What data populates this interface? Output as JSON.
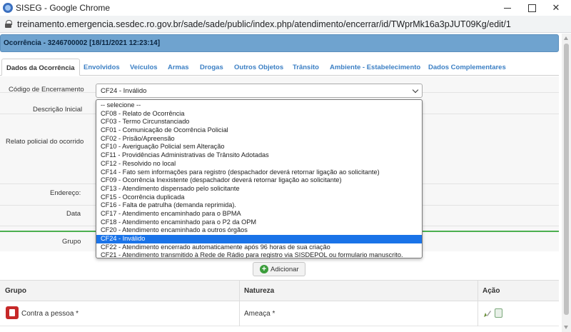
{
  "window": {
    "title": "SISEG - Google Chrome"
  },
  "browser": {
    "url": "treinamento.emergencia.sesdec.ro.gov.br/sade/sade/public/index.php/atendimento/encerrar/id/TWprMk16a3pJUT09Kg/edit/1"
  },
  "occurrence": {
    "header": "Ocorrência - 3246700002 [18/11/2021 12:23:14]"
  },
  "tabs": [
    {
      "label": "Dados da Ocorrência"
    },
    {
      "label": "Envolvidos"
    },
    {
      "label": "Veículos"
    },
    {
      "label": "Armas"
    },
    {
      "label": "Drogas"
    },
    {
      "label": "Outros Objetos"
    },
    {
      "label": "Trânsito"
    },
    {
      "label": "Ambiente - Estabelecimento"
    },
    {
      "label": "Dados Complementares"
    }
  ],
  "form": {
    "codigo_label": "Código de Encerramento",
    "descricao_label": "Descrição Inicial",
    "relato_label": "Relato policial do ocorrido",
    "endereco_label": "Endereço:",
    "data_label": "Data",
    "grupo_label": "Grupo",
    "selected_value": "CF24 - Inválido"
  },
  "dropdown": {
    "options": [
      "-- selecione --",
      "CF08 - Relato de Ocorrência",
      "CF03 - Termo Circunstanciado",
      "CF01 - Comunicação de Ocorrência Policial",
      "CF02 - Prisão/Apreensão",
      "CF10 - Averiguação Policial sem Alteração",
      "CF11 - Providências Administrativas de Trânsito Adotadas",
      "CF12 - Resolvido no local",
      "CF14 - Fato sem informações para registro (despachador deverá retornar ligação ao solicitante)",
      "CF09 - Ocorrência Inexistente (despachador deverá retornar ligação ao solicitante)",
      "CF13 - Atendimento dispensado pelo solicitante",
      "CF15 - Ocorrência duplicada",
      "CF16 - Falta de patrulha (demanda reprimida).",
      "CF17 - Atendimento encaminhado para o BPMA",
      "CF18 - Atendimento encaminhado para o P2 da OPM",
      "CF20 - Atendimento encaminhado a outros órgãos",
      "CF24 - Inválido",
      "CF22 - Atendimento encerrado automaticamente após 96 horas de sua criação",
      "CF21 - Atendimento transmitido à Rede de Rádio para registro via SISDEPOL ou formulario manuscrito."
    ],
    "selected_index": 16
  },
  "actions": {
    "add_label": "Adicionar"
  },
  "table": {
    "headers": {
      "grupo": "Grupo",
      "natureza": "Natureza",
      "acao": "Ação"
    },
    "rows": [
      {
        "grupo": "Contra a pessoa *",
        "natureza": "Ameaça *"
      }
    ]
  }
}
